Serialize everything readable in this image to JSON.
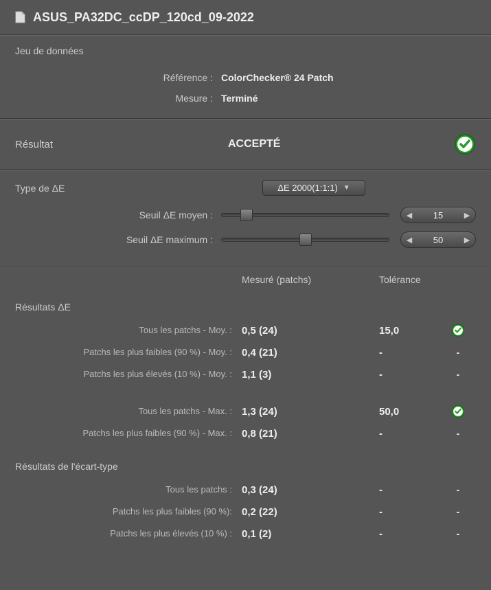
{
  "title": "ASUS_PA32DC_ccDP_120cd_09-2022",
  "dataset": {
    "heading": "Jeu de données",
    "reference_label": "Référence :",
    "reference_value": "ColorChecker® 24 Patch",
    "measure_label": "Mesure :",
    "measure_value": "Terminé"
  },
  "result": {
    "label": "Résultat",
    "value": "ACCEPTÉ",
    "status": "ok"
  },
  "deltaE": {
    "type_label": "Type de ΔE",
    "type_value": "ΔE 2000(1:1:1)",
    "avg_threshold_label": "Seuil ΔE moyen :",
    "avg_threshold_value": "15",
    "avg_threshold_pct": 15,
    "max_threshold_label": "Seuil ΔE maximum :",
    "max_threshold_value": "50",
    "max_threshold_pct": 50
  },
  "columns": {
    "measured": "Mesuré (patchs)",
    "tolerance": "Tolérance"
  },
  "results_deltaE": {
    "heading": "Résultats ΔE",
    "rows": [
      {
        "label": "Tous les patchs - Moy. :",
        "measured": "0,5  (24)",
        "tolerance": "15,0",
        "status": "ok"
      },
      {
        "label": "Patchs les plus faibles (90 %) - Moy. :",
        "measured": "0,4  (21)",
        "tolerance": "-",
        "status": "-"
      },
      {
        "label": "Patchs les plus élevés (10 %) - Moy. :",
        "measured": "1,1   (3)",
        "tolerance": "-",
        "status": "-"
      },
      {
        "label": "Tous les patchs - Max. :",
        "measured": "1,3   (24)",
        "tolerance": "50,0",
        "status": "ok"
      },
      {
        "label": "Patchs les plus faibles (90 %) - Max. :",
        "measured": "0,8  (21)",
        "tolerance": "-",
        "status": "-"
      }
    ]
  },
  "results_stddev": {
    "heading": "Résultats de l'écart-type",
    "rows": [
      {
        "label": "Tous les patchs :",
        "measured": "0,3  (24)",
        "tolerance": "-",
        "status": "-"
      },
      {
        "label": "Patchs les plus faibles (90 %):",
        "measured": "0,2  (22)",
        "tolerance": "-",
        "status": "-"
      },
      {
        "label": "Patchs les plus élevés (10 %) :",
        "measured": "0,1 (2)",
        "tolerance": "-",
        "status": "-"
      }
    ]
  }
}
